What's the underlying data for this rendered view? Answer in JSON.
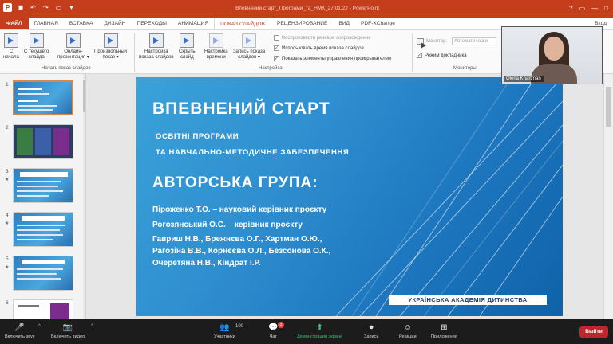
{
  "window": {
    "title": "Впевнений старт_Програми_та_НМК_27.01.22 - PowerPoint"
  },
  "tabs": [
    {
      "label": "ФАЙЛ"
    },
    {
      "label": "ГЛАВНАЯ"
    },
    {
      "label": "ВСТАВКА"
    },
    {
      "label": "ДИЗАЙН"
    },
    {
      "label": "ПЕРЕХОДЫ"
    },
    {
      "label": "АНИМАЦИЯ"
    },
    {
      "label": "ПОКАЗ СЛАЙДОВ"
    },
    {
      "label": "РЕЦЕНЗИРОВАНИЕ"
    },
    {
      "label": "ВИД"
    },
    {
      "label": "PDF-XChange"
    }
  ],
  "tab_user": "Вход",
  "ribbon": {
    "buttons": [
      {
        "line1": "С",
        "line2": "начала"
      },
      {
        "line1": "С текущего",
        "line2": "слайда"
      },
      {
        "line1": "Онлайн-",
        "line2": "презентация ▾"
      },
      {
        "line1": "Произвольный",
        "line2": "показ ▾"
      },
      {
        "line1": "Настройка",
        "line2": "показа слайдов"
      },
      {
        "line1": "Скрыть",
        "line2": "слайд"
      },
      {
        "line1": "Настройка",
        "line2": "времени"
      },
      {
        "line1": "Запись показа",
        "line2": "слайдов ▾"
      }
    ],
    "groups": {
      "start": "Начать показ слайдов",
      "setup": "Настройка",
      "monitors": "Мониторы"
    },
    "checks": [
      {
        "label": "Воспроизвести речевое сопровождение",
        "on": false
      },
      {
        "label": "Использовать время показа слайдов",
        "on": true
      },
      {
        "label": "Показать элементы управления проигрывателем",
        "on": true
      }
    ],
    "monitor_label": "Монитор:",
    "monitor_value": "Автоматически",
    "presenter_view": "Режим докладчика",
    "check_mark": "✓"
  },
  "thumbnails": [
    {
      "num": "1",
      "star": ""
    },
    {
      "num": "2",
      "star": ""
    },
    {
      "num": "3",
      "star": "★"
    },
    {
      "num": "4",
      "star": "★"
    },
    {
      "num": "5",
      "star": "★"
    },
    {
      "num": "6",
      "star": ""
    }
  ],
  "slide": {
    "title": "ВПЕВНЕНИЙ СТАРТ",
    "subtitle1": "ОСВІТНІ ПРОГРАМИ",
    "subtitle2": "ТА НАВЧАЛЬНО-МЕТОДИЧНЕ ЗАБЕЗПЕЧЕННЯ",
    "group_heading": "АВТОРСЬКА ГРУПА:",
    "lines": [
      "Піроженко Т.О. – науковий керівник проєкту",
      "Рогозянський О.С. – керівник проєкту",
      "Гавриш Н.В., Брежнєва О.Г., Хартман О.Ю.,",
      "Рагозіна В.В., Корнєєва О.Л., Безсонова О.К.,",
      "Очеретяна Н.В., Кіндрат І.Р."
    ],
    "footer": "УКРАЇНСЬКА АКАДЕМІЯ ДИТИНСТВА"
  },
  "video": {
    "name": "Olena Khartman"
  },
  "zoom": {
    "participants_count": "100",
    "chat_badge": "3",
    "items": [
      {
        "label": "Включить звук",
        "icon": "🎤"
      },
      {
        "label": "Включить видео",
        "icon": "📷"
      },
      {
        "label": "Участники",
        "icon": "👥"
      },
      {
        "label": "Чат",
        "icon": "💬"
      },
      {
        "label": "Демонстрация экрана",
        "icon": "⬆"
      },
      {
        "label": "Запись",
        "icon": "⏺"
      },
      {
        "label": "Реакции",
        "icon": "☺"
      },
      {
        "label": "Приложения",
        "icon": "⊞"
      }
    ],
    "leave": "Выйти"
  }
}
